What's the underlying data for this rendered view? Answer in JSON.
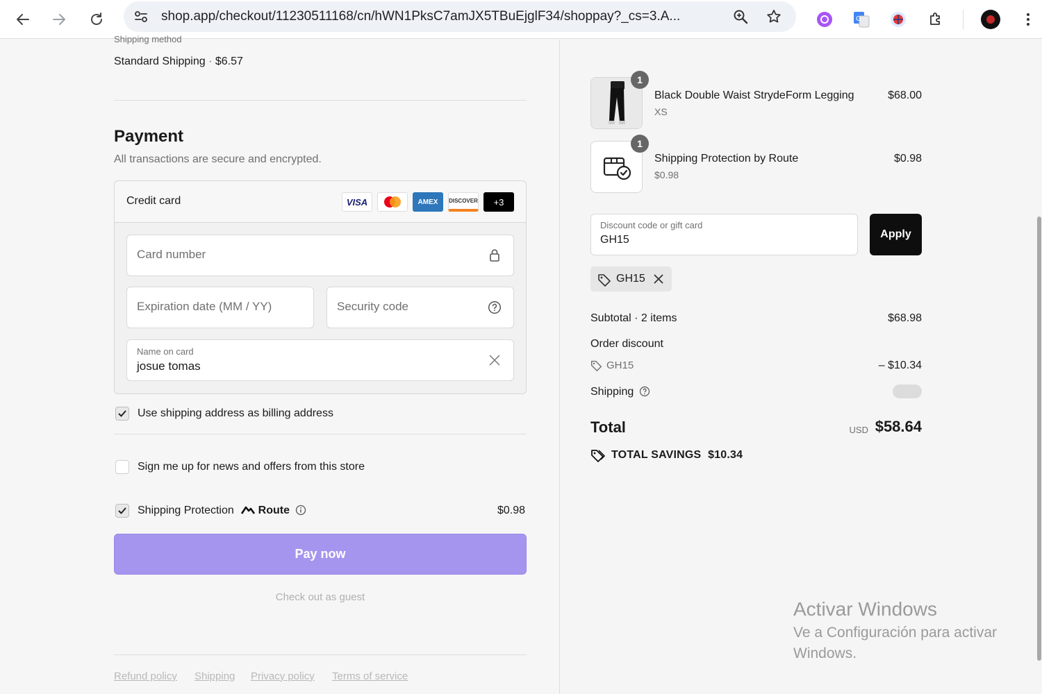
{
  "browser": {
    "url": "shop.app/checkout/11230511168/cn/hWN1PksC7amJX5TBuEjglF34/shoppay?_cs=3.A...",
    "icons": [
      "back-icon",
      "forward-icon",
      "reload-icon",
      "site-settings-icon",
      "zoom-icon",
      "bookmark-star-icon",
      "extension-purple-icon",
      "google-translate-icon",
      "extension-shield-icon",
      "extensions-puzzle-icon",
      "profile-avatar",
      "menu-kebab-icon"
    ]
  },
  "shipping": {
    "label": "Shipping method",
    "method": "Standard Shipping",
    "separator": "·",
    "price": "$6.57"
  },
  "payment": {
    "title": "Payment",
    "subtitle": "All transactions are secure and encrypted.",
    "method_label": "Credit card",
    "brands": [
      "VISA",
      "Mastercard",
      "AMEX",
      "DISCOVER",
      "+3"
    ],
    "card_number_placeholder": "Card number",
    "expiration_placeholder": "Expiration date (MM / YY)",
    "security_placeholder": "Security code",
    "name_label": "Name on card",
    "name_value": "josue tomas"
  },
  "options": {
    "billing_same": {
      "label": "Use shipping address as billing address",
      "checked": true
    },
    "newsletter": {
      "label": "Sign me up for news and offers from this store",
      "checked": false
    },
    "protection": {
      "label": "Shipping Protection",
      "brand": "Route",
      "price": "$0.98",
      "checked": true
    }
  },
  "actions": {
    "pay_now": "Pay now",
    "guest": "Check out as guest"
  },
  "footer": {
    "links": [
      "Refund policy",
      "Shipping",
      "Privacy policy",
      "Terms of service"
    ]
  },
  "summary": {
    "items": [
      {
        "name": "Black Double Waist StrydeForm Legging",
        "variant": "XS",
        "price": "$68.00",
        "qty": "1"
      },
      {
        "name": "Shipping Protection by Route",
        "variant": "$0.98",
        "price": "$0.98",
        "qty": "1"
      }
    ],
    "discount_label": "Discount code or gift card",
    "discount_value": "GH15",
    "apply": "Apply",
    "applied_code": "GH15",
    "subtotal_label": "Subtotal · 2 items",
    "subtotal_value": "$68.98",
    "order_discount_label": "Order discount",
    "order_discount_code": "GH15",
    "order_discount_value": "– $10.34",
    "shipping_label": "Shipping",
    "total_label": "Total",
    "currency": "USD",
    "total_value": "$58.64",
    "savings_label": "TOTAL SAVINGS",
    "savings_value": "$10.34"
  },
  "watermark": {
    "line1": "Activar Windows",
    "line2": "Ve a Configuración para activar",
    "line3": "Windows."
  },
  "colors": {
    "pay_button": "#a695ee",
    "apply_button": "#0e0e0e",
    "background": "#f6f6f6"
  }
}
